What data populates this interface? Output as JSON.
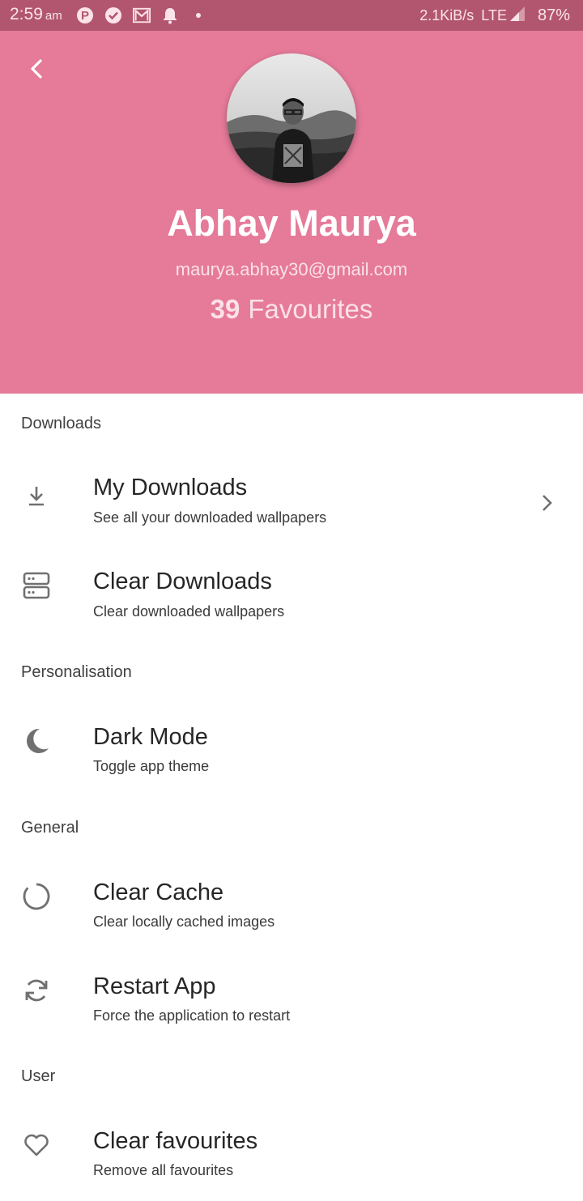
{
  "status_bar": {
    "time": "2:59",
    "ampm": "am",
    "net_speed": "2.1KiB/s",
    "network": "LTE",
    "battery": "87%"
  },
  "profile": {
    "name": "Abhay Maurya",
    "email": "maurya.abhay30@gmail.com",
    "favourites_count": "39",
    "favourites_label": "Favourites"
  },
  "sections": {
    "downloads": "Downloads",
    "personalisation": "Personalisation",
    "general": "General",
    "user": "User"
  },
  "items": {
    "my_downloads": {
      "title": "My Downloads",
      "subtitle": "See all your downloaded wallpapers"
    },
    "clear_downloads": {
      "title": "Clear Downloads",
      "subtitle": "Clear downloaded wallpapers"
    },
    "dark_mode": {
      "title": "Dark Mode",
      "subtitle": "Toggle app theme"
    },
    "clear_cache": {
      "title": "Clear Cache",
      "subtitle": "Clear locally cached images"
    },
    "restart_app": {
      "title": "Restart App",
      "subtitle": "Force the application to restart"
    },
    "clear_favourites": {
      "title": "Clear favourites",
      "subtitle": "Remove all favourites"
    }
  },
  "colors": {
    "header_bg": "#e57a99",
    "status_bar_bg": "#b2566f",
    "icon_gray": "#707070"
  },
  "icons": {
    "back": "back-arrow-icon",
    "download": "download-icon",
    "storage": "storage-icon",
    "dark_mode": "moon-icon",
    "cache": "loading-circle-icon",
    "restart": "refresh-icon",
    "favourites": "heart-icon",
    "chevron": "chevron-right-icon"
  }
}
